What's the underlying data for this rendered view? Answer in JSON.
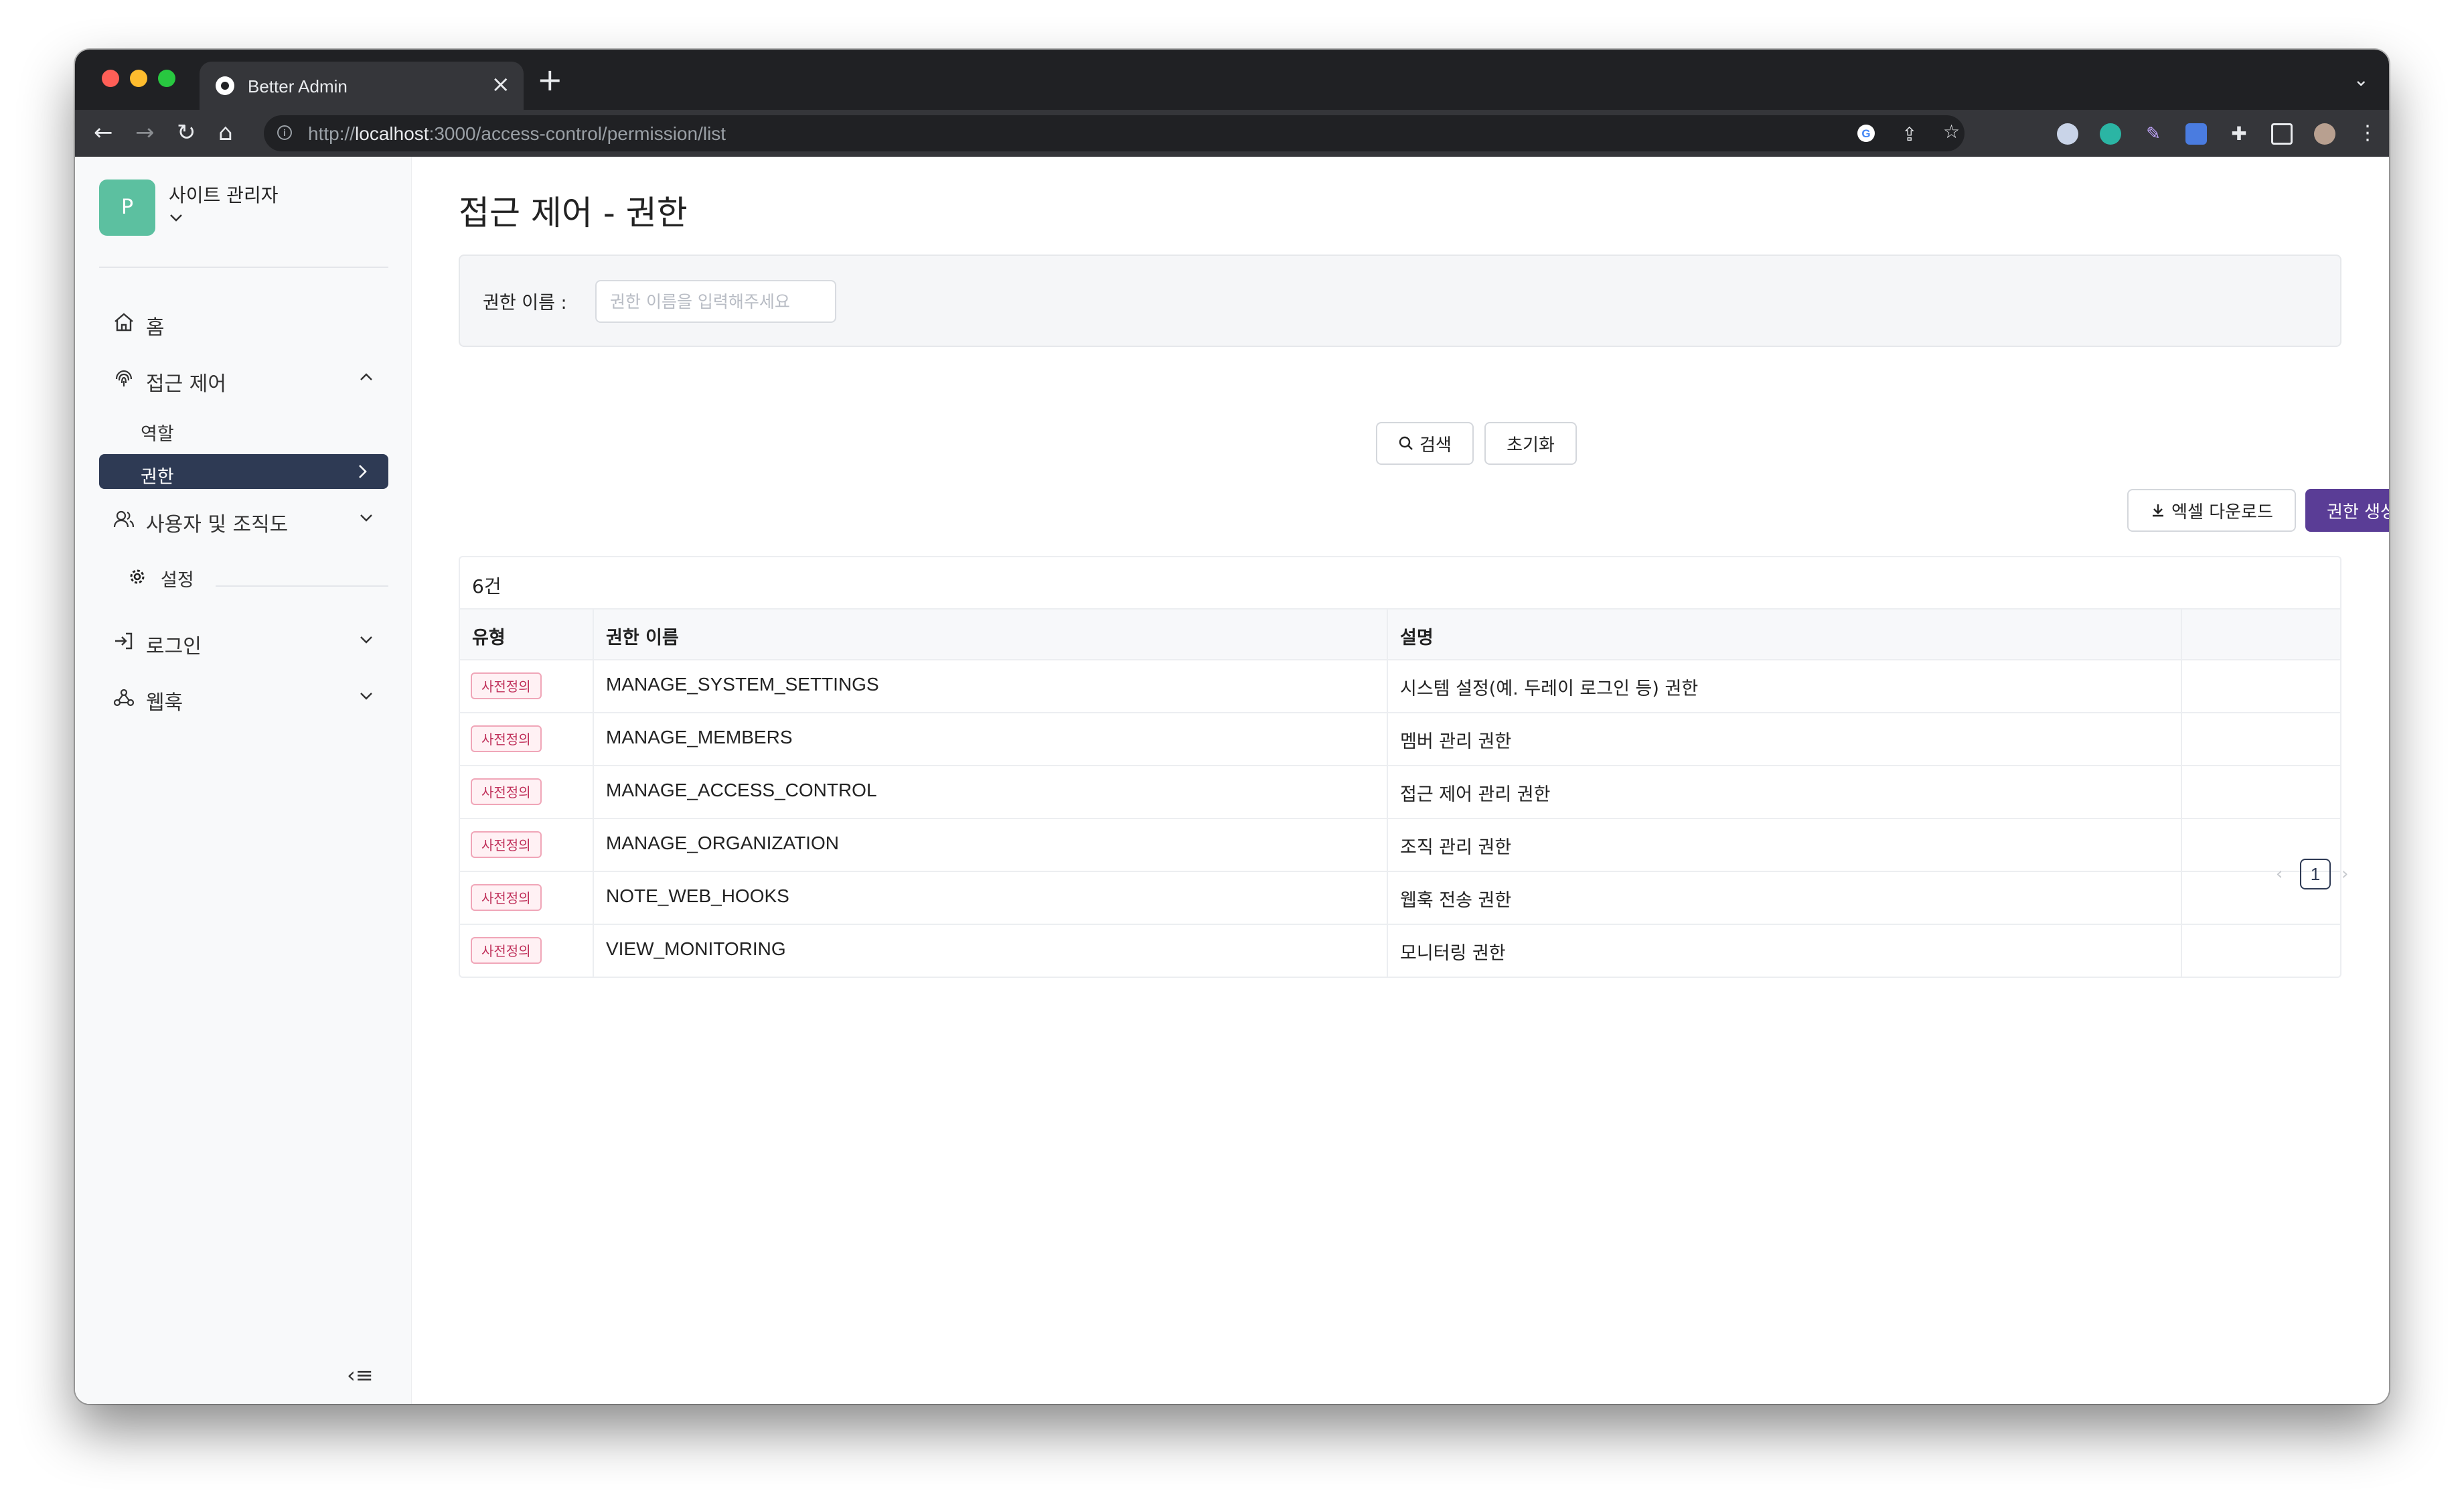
{
  "browser": {
    "tab_title": "Better Admin",
    "url_prefix": "http://",
    "url_host": "localhost",
    "url_rest": ":3000/access-control/permission/list"
  },
  "sidebar": {
    "avatar_letter": "P",
    "site_name": "사이트 관리자",
    "items": [
      {
        "label": "홈",
        "icon": "home-icon"
      },
      {
        "label": "접근 제어",
        "icon": "fingerprint-icon",
        "expanded": true
      },
      {
        "label": "사용자 및 조직도",
        "icon": "users-icon"
      },
      {
        "label": "설정",
        "icon": "gear-icon"
      },
      {
        "label": "로그인",
        "icon": "login-icon"
      },
      {
        "label": "웹훅",
        "icon": "webhook-icon"
      }
    ],
    "sub_items": [
      {
        "label": "역할"
      },
      {
        "label": "권한",
        "active": true
      }
    ]
  },
  "page": {
    "title": "접근 제어 - 권한",
    "search_label": "권한 이름 :",
    "search_placeholder": "권한 이름을 입력해주세요",
    "search_button": "검색",
    "reset_button": "초기화",
    "excel_button": "엑셀 다운로드",
    "create_button": "권한 생성",
    "count": "6건"
  },
  "table": {
    "headers": [
      "유형",
      "권한 이름",
      "설명"
    ],
    "rows": [
      {
        "type": "사전정의",
        "name": "MANAGE_SYSTEM_SETTINGS",
        "desc": "시스템 설정(예. 두레이 로그인 등) 권한"
      },
      {
        "type": "사전정의",
        "name": "MANAGE_MEMBERS",
        "desc": "멤버 관리 권한"
      },
      {
        "type": "사전정의",
        "name": "MANAGE_ACCESS_CONTROL",
        "desc": "접근 제어 관리 권한"
      },
      {
        "type": "사전정의",
        "name": "MANAGE_ORGANIZATION",
        "desc": "조직 관리 권한"
      },
      {
        "type": "사전정의",
        "name": "NOTE_WEB_HOOKS",
        "desc": "웹훅 전송 권한"
      },
      {
        "type": "사전정의",
        "name": "VIEW_MONITORING",
        "desc": "모니터링 권한"
      }
    ]
  },
  "pagination": {
    "current": "1"
  },
  "colors": {
    "primary": "#5a3d96",
    "active_menu": "#2e3a54",
    "badge_text": "#c0305a",
    "avatar": "#5cc0a0"
  }
}
